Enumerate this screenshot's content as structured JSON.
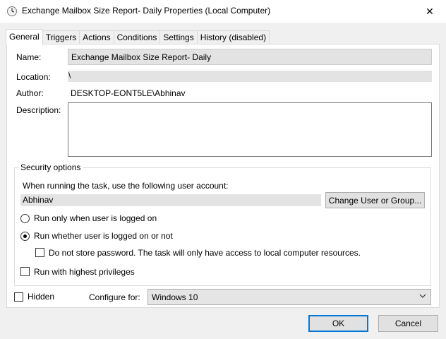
{
  "window": {
    "title": "Exchange Mailbox Size Report- Daily Properties (Local Computer)",
    "close_glyph": "✕",
    "icon": "task-scheduler-clock-icon"
  },
  "tabs": [
    {
      "label": "General",
      "active": true
    },
    {
      "label": "Triggers"
    },
    {
      "label": "Actions"
    },
    {
      "label": "Conditions"
    },
    {
      "label": "Settings"
    },
    {
      "label": "History (disabled)"
    }
  ],
  "general": {
    "name_label": "Name:",
    "name_value": "Exchange Mailbox Size Report- Daily",
    "location_label": "Location:",
    "location_value": "\\",
    "author_label": "Author:",
    "author_value": "DESKTOP-EONT5LE\\Abhinav",
    "description_label": "Description:",
    "description_value": ""
  },
  "security": {
    "group_title": "Security options",
    "account_prompt": "When running the task, use the following user account:",
    "account_value": "Abhinav",
    "change_button": "Change User or Group...",
    "radio_logged_on": "Run only when user is logged on",
    "radio_logged_on_checked": false,
    "radio_whether": "Run whether user is logged on or not",
    "radio_whether_checked": true,
    "no_store_password": "Do not store password.  The task will only have access to local computer resources.",
    "no_store_password_checked": false,
    "highest_privileges": "Run with highest privileges",
    "highest_privileges_checked": false
  },
  "footer": {
    "hidden_label": "Hidden",
    "hidden_checked": false,
    "configure_label": "Configure for:",
    "configure_value": "Windows 10",
    "ok_button": "OK",
    "cancel_button": "Cancel"
  },
  "colors": {
    "background": "#f0f0f0",
    "panel": "#ffffff",
    "default_button_border": "#0078d7"
  }
}
